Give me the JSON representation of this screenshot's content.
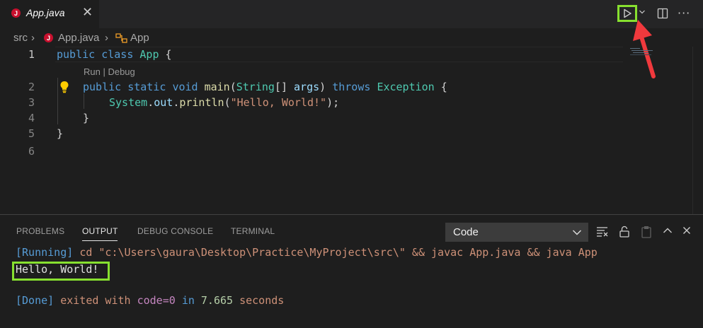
{
  "tab": {
    "icon_letter": "J",
    "filename": "App.java",
    "close_glyph": "✕"
  },
  "toolbar": {
    "run_icon": "play-icon",
    "more_glyph": "···"
  },
  "breadcrumb": {
    "folder": "src",
    "sep": "›",
    "file": "App.java",
    "class_name": "App"
  },
  "editor": {
    "line_numbers": [
      "1",
      "2",
      "3",
      "4",
      "5",
      "6"
    ],
    "codelens": "Run | Debug",
    "line1": {
      "kw1": "public",
      "kw2": "class",
      "cls": "App",
      "brace": "{"
    },
    "line2": {
      "kw1": "public",
      "kw2": "static",
      "kw3": "void",
      "fn": "main",
      "p1": "(",
      "type": "String",
      "arr": "[] ",
      "arg": "args",
      "p2": ")",
      "kw4": "throws",
      "ex": "Exception",
      "brace": "{"
    },
    "line3": {
      "cls": "System",
      "dot1": ".",
      "field": "out",
      "dot2": ".",
      "fn": "println",
      "p1": "(",
      "str": "\"Hello, World!\"",
      "p2": ");"
    },
    "line4": {
      "brace": "}"
    },
    "line5": {
      "brace": "}"
    }
  },
  "panel": {
    "tabs": [
      "PROBLEMS",
      "OUTPUT",
      "DEBUG CONSOLE",
      "TERMINAL"
    ],
    "active_tab": "OUTPUT",
    "channel": "Code",
    "output": {
      "running_tag": "[Running]",
      "command": "cd \"c:\\Users\\gaura\\Desktop\\Practice\\MyProject\\src\\\" && javac App.java && java App",
      "hello": "Hello, World!",
      "done_tag": "[Done]",
      "exited_with": "exited with",
      "code_eq": "code=0",
      "in": "in",
      "time": "7.665",
      "seconds": "seconds"
    }
  },
  "colors": {
    "highlight": "#87e02f",
    "arrow": "#f0393d"
  }
}
